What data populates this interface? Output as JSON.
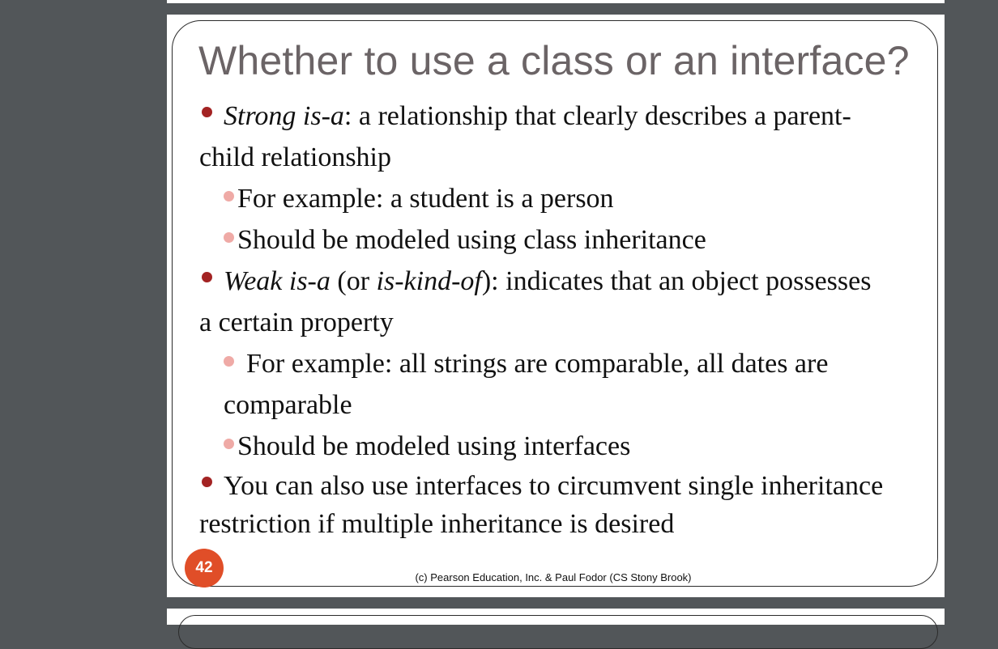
{
  "slide": {
    "title": "Whether to use a class or an interface?",
    "bullet1": {
      "term": "Strong is-a",
      "text_line1": ": a relationship that clearly describes a parent-",
      "text_line2": "child relationship"
    },
    "sub1": "For example: a student is a person",
    "sub2": "Should be modeled using class inheritance",
    "bullet2": {
      "term": "Weak is-a",
      "open_paren": " (or ",
      "term2": "is-kind-of",
      "text_line1": "): indicates that an object possesses",
      "text_line2": "a certain property"
    },
    "sub3_line1": "For example: all strings are comparable, all dates are",
    "sub3_line2": "comparable",
    "sub4": "Should be modeled using interfaces",
    "bullet3_line1": "You can also use interfaces to circumvent single inheritance",
    "bullet3_line2": "restriction if multiple inheritance is desired",
    "page_number": "42",
    "footer": "(c) Pearson Education, Inc. & Paul Fodor (CS Stony Brook)"
  },
  "colors": {
    "viewer_background": "#525659",
    "title": "#6b6466",
    "bullet": "#a32323",
    "sub_bullet": "#efaaa6",
    "page_badge": "#e04e28"
  }
}
